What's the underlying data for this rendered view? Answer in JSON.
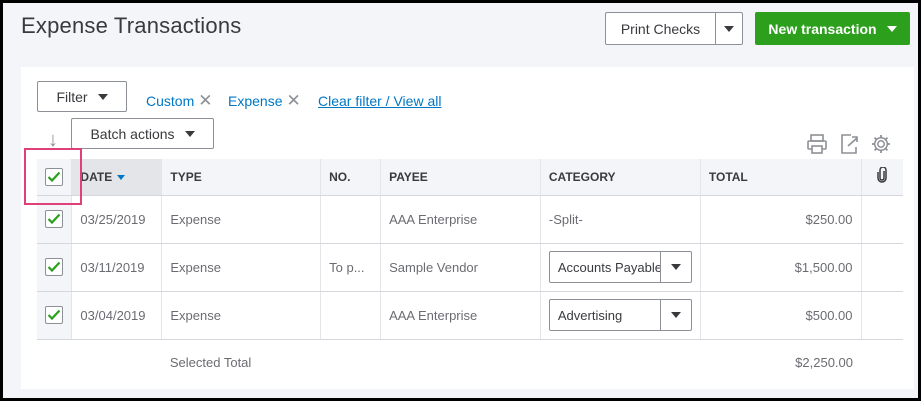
{
  "page": {
    "title": "Expense Transactions"
  },
  "header": {
    "print_checks_label": "Print Checks",
    "new_transaction_label": "New transaction"
  },
  "filters": {
    "filter_label": "Filter",
    "chips": [
      "Custom",
      "Expense"
    ],
    "clear_label": "Clear filter / View all"
  },
  "batch": {
    "label": "Batch actions"
  },
  "table": {
    "columns": {
      "date": "DATE",
      "type": "TYPE",
      "no": "NO.",
      "payee": "PAYEE",
      "category": "CATEGORY",
      "total": "TOTAL"
    },
    "header_checked": true,
    "rows": [
      {
        "checked": true,
        "date": "03/25/2019",
        "type": "Expense",
        "no": "",
        "payee": "AAA Enterprise",
        "category": "-Split-",
        "category_is_select": false,
        "total": "$250.00"
      },
      {
        "checked": true,
        "date": "03/11/2019",
        "type": "Expense",
        "no": "To p...",
        "payee": "Sample Vendor",
        "category": "Accounts Payable",
        "category_is_select": true,
        "total": "$1,500.00"
      },
      {
        "checked": true,
        "date": "03/04/2019",
        "type": "Expense",
        "no": "",
        "payee": "AAA Enterprise",
        "category": "Advertising",
        "category_is_select": true,
        "total": "$500.00"
      }
    ],
    "footer": {
      "label": "Selected Total",
      "total": "$2,250.00"
    }
  },
  "icons": {
    "print": "printer-icon",
    "export": "export-icon",
    "settings": "gear-icon",
    "attachment": "paperclip-icon",
    "batch_arrow": "arrow-down-icon"
  },
  "colors": {
    "accent_green": "#2ca01c",
    "link_blue": "#0077c5",
    "highlight_pink": "#e0407a",
    "check_green": "#2ca01c"
  }
}
